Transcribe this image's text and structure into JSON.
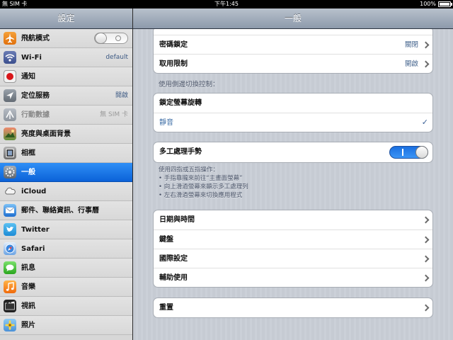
{
  "status_bar": {
    "carrier": "無 SIM 卡",
    "time": "下午1:45",
    "battery": "100%"
  },
  "sidebar": {
    "title": "設定",
    "items": [
      {
        "label": "飛航模式",
        "icon": "airplane-icon"
      },
      {
        "label": "Wi-Fi",
        "value": "default",
        "icon": "wifi-icon"
      },
      {
        "label": "通知",
        "icon": "notifications-icon"
      },
      {
        "label": "定位服務",
        "value": "開啟",
        "icon": "location-icon"
      },
      {
        "label": "行動數據",
        "value": "無 SIM 卡",
        "icon": "cellular-data-icon"
      },
      {
        "label": "亮度與桌面背景",
        "icon": "brightness-icon"
      },
      {
        "label": "相框",
        "icon": "picture-frame-icon"
      },
      {
        "label": "一般",
        "icon": "gear-icon"
      },
      {
        "label": "iCloud",
        "icon": "icloud-icon"
      },
      {
        "label": "郵件、聯絡資訊、行事曆",
        "icon": "mail-icon"
      },
      {
        "label": "Twitter",
        "icon": "twitter-icon"
      },
      {
        "label": "Safari",
        "icon": "safari-icon"
      },
      {
        "label": "訊息",
        "icon": "messages-icon"
      },
      {
        "label": "音樂",
        "icon": "music-icon"
      },
      {
        "label": "視訊",
        "icon": "video-icon"
      },
      {
        "label": "照片",
        "icon": "photos-icon"
      }
    ],
    "selected_index": 7,
    "airplane_toggle_on": false
  },
  "main": {
    "title": "一般",
    "passcode": {
      "label": "密碼鎖定",
      "value": "關閉"
    },
    "restrictions": {
      "label": "取用限制",
      "value": "開啟"
    },
    "side_switch_header": "使用側邊切換控制：",
    "lock_rotation": "鎖定螢幕旋轉",
    "mute": "靜音",
    "mute_checked": true,
    "multitasking": {
      "label": "多工處理手勢",
      "on": true
    },
    "multitasking_footer": [
      "使用四指或五指操作：",
      "• 手指靠攏來前往“主畫面螢幕”",
      "• 向上滑過螢幕來顯示多工處理列",
      "• 左右滑過螢幕來切換應用程式"
    ],
    "date_time": "日期與時間",
    "keyboard": "鍵盤",
    "international": "國際設定",
    "accessibility": "輔助使用",
    "reset": "重置"
  },
  "colors": {
    "selected_row": "#0b62d8",
    "toggle_on": "#1a6fe0",
    "value_text": "#3e5f8a"
  }
}
